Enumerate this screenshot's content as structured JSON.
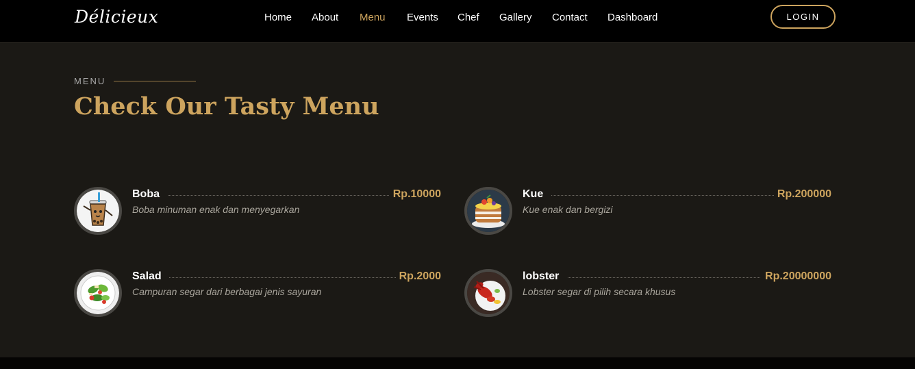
{
  "brand": {
    "logo": "Délicieux"
  },
  "nav": {
    "items": [
      {
        "label": "Home"
      },
      {
        "label": "About"
      },
      {
        "label": "Menu"
      },
      {
        "label": "Events"
      },
      {
        "label": "Chef"
      },
      {
        "label": "Gallery"
      },
      {
        "label": "Contact"
      },
      {
        "label": "Dashboard"
      }
    ],
    "active": "Menu",
    "login_label": "LOGIN"
  },
  "section": {
    "kicker": "MENU",
    "title": "Check Our Tasty Menu"
  },
  "menu": {
    "items": [
      {
        "name": "Boba",
        "price": "Rp.10000",
        "description": "Boba minuman enak dan menyegarkan",
        "icon": "boba-drink-icon"
      },
      {
        "name": "Kue",
        "price": "Rp.200000",
        "description": "Kue enak dan bergizi",
        "icon": "cake-icon"
      },
      {
        "name": "Salad",
        "price": "Rp.2000",
        "description": "Campuran segar dari berbagai jenis sayuran",
        "icon": "salad-icon"
      },
      {
        "name": "lobster",
        "price": "Rp.20000000",
        "description": "Lobster segar di pilih secara khusus",
        "icon": "lobster-icon"
      }
    ]
  },
  "colors": {
    "accent": "#cda45e",
    "section_bg": "#1b1915",
    "nav_bg": "#000000",
    "text": "#ffffff",
    "muted_text": "#a9a59c"
  }
}
